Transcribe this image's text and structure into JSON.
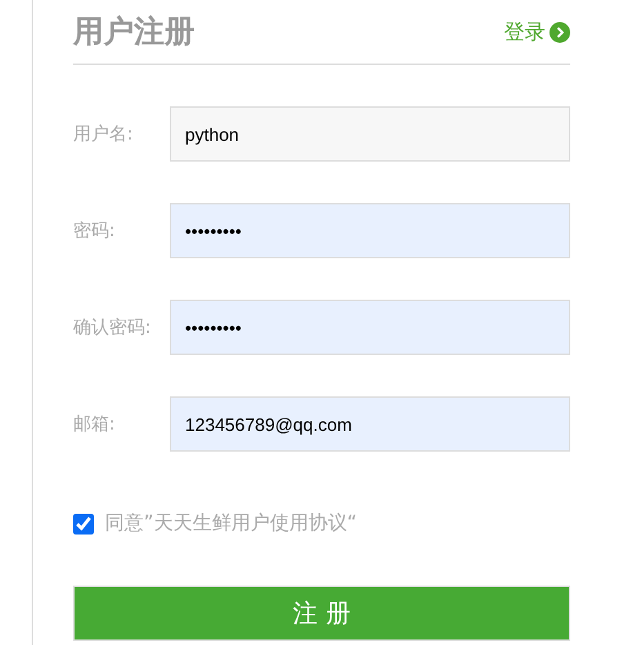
{
  "title": "用户注册",
  "login_link": "登录",
  "fields": [
    {
      "label": "用户名:",
      "value": "python",
      "autofilled": false
    },
    {
      "label": "密码:",
      "value": "•••••••••",
      "autofilled": true
    },
    {
      "label": "确认密码:",
      "value": "•••••••••",
      "autofilled": true
    },
    {
      "label": "邮箱:",
      "value": "123456789@qq.com",
      "autofilled": true
    }
  ],
  "agreement": {
    "label": "同意”天天生鲜用户使用协议“",
    "checked": true
  },
  "submit": "注 册"
}
